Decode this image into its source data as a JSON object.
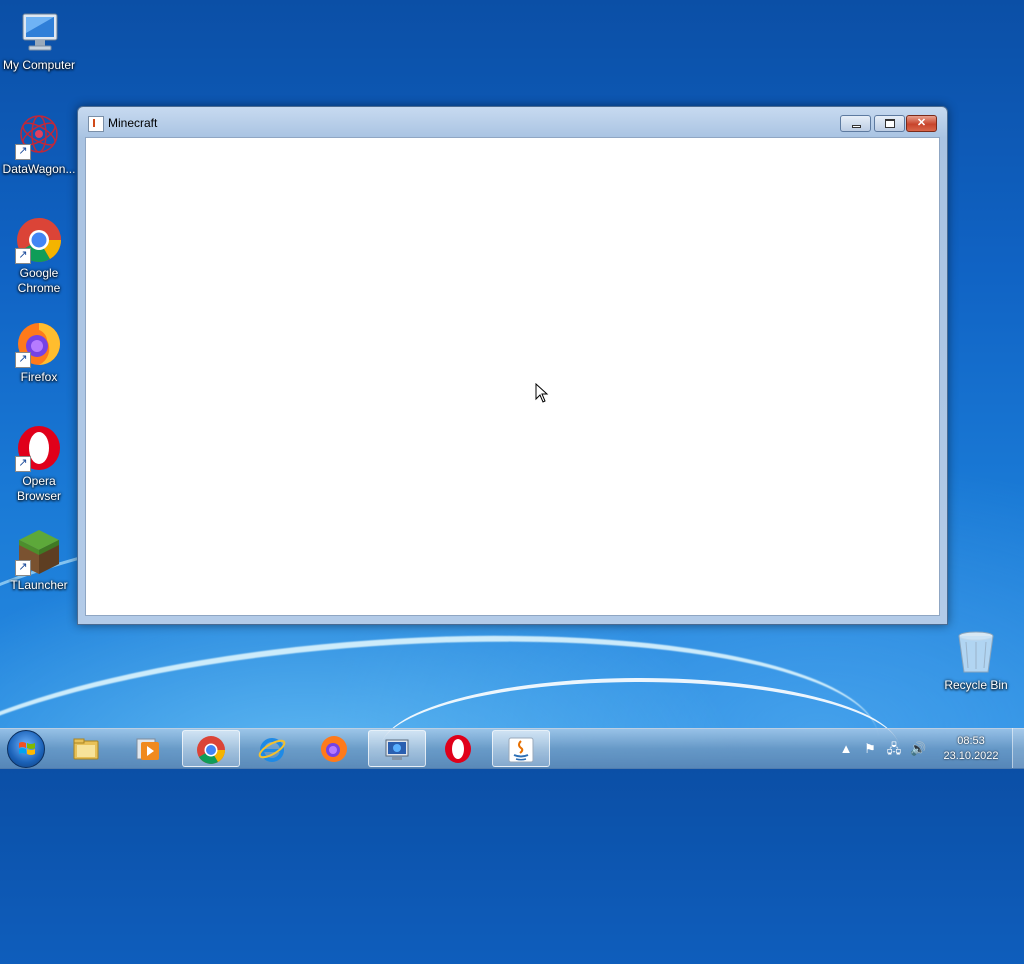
{
  "desktop": {
    "icons": [
      {
        "label": "My Computer",
        "icon": "computer-icon"
      },
      {
        "label": "DataWagon...",
        "icon": "datawagon-icon"
      },
      {
        "label": "Google Chrome",
        "icon": "chrome-icon"
      },
      {
        "label": "Firefox",
        "icon": "firefox-icon"
      },
      {
        "label": "Opera Browser",
        "icon": "opera-icon"
      },
      {
        "label": "TLauncher",
        "icon": "minecraft-grass-block-icon"
      }
    ],
    "recycle_bin": {
      "label": "Recycle Bin",
      "icon": "recycle-bin-icon"
    }
  },
  "window": {
    "title": "Minecraft",
    "icon": "java-icon",
    "controls": {
      "minimize": "minimize-icon",
      "maximize": "maximize-icon",
      "close": "close-icon"
    }
  },
  "taskbar": {
    "start": {
      "icon": "windows-start-icon"
    },
    "buttons": [
      {
        "icon": "explorer-folder-icon",
        "active": false
      },
      {
        "icon": "media-player-icon",
        "active": false
      },
      {
        "icon": "chrome-icon",
        "active": true
      },
      {
        "icon": "internet-explorer-icon",
        "active": false
      },
      {
        "icon": "firefox-icon",
        "active": false
      },
      {
        "icon": "system-info-monitor-icon",
        "active": true
      },
      {
        "icon": "opera-icon",
        "active": false
      },
      {
        "icon": "java-icon",
        "active": true
      }
    ],
    "tray": {
      "icons": [
        "show-hidden-arrow-icon",
        "action-center-flag-icon",
        "network-icon",
        "volume-icon"
      ],
      "time": "08:53",
      "date": "23.10.2022"
    }
  },
  "colors": {
    "close_button": "#c8452c",
    "desktop_blue": "#1063c4"
  }
}
